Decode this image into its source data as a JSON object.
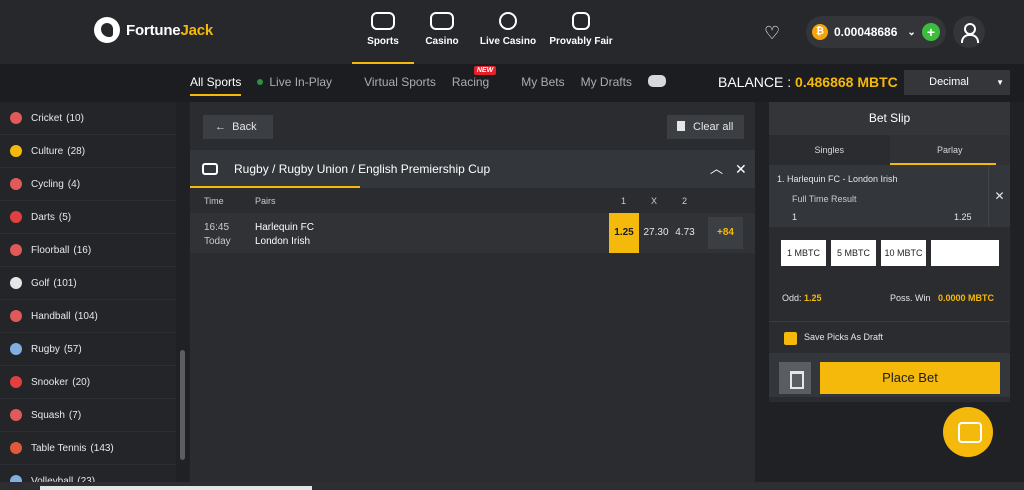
{
  "brand": {
    "name_part1": "Fortune",
    "name_part2": "Jack"
  },
  "main_nav": [
    {
      "label": "Sports"
    },
    {
      "label": "Casino"
    },
    {
      "label": "Live Casino"
    },
    {
      "label": "Provably Fair"
    }
  ],
  "wallet": {
    "amount": "0.00048686",
    "coin": "₿"
  },
  "sub_nav": {
    "tabs": [
      "All Sports",
      "Live In-Play",
      "Virtual Sports",
      "Racing",
      "My Bets",
      "My Drafts"
    ],
    "new_badge": "NEW"
  },
  "balance": {
    "label": "BALANCE : ",
    "value": "0.486868 MBTC"
  },
  "odds_format": "Decimal",
  "sidebar": {
    "items": [
      {
        "label": "Cricket",
        "count": "(10)",
        "color": "#e05a5a"
      },
      {
        "label": "Culture",
        "count": "(28)",
        "color": "#f5b90b"
      },
      {
        "label": "Cycling",
        "count": "(4)",
        "color": "#e05a5a"
      },
      {
        "label": "Darts",
        "count": "(5)",
        "color": "#e04040"
      },
      {
        "label": "Floorball",
        "count": "(16)",
        "color": "#e05a5a"
      },
      {
        "label": "Golf",
        "count": "(101)",
        "color": "#e6e6e6"
      },
      {
        "label": "Handball",
        "count": "(104)",
        "color": "#e05a5a"
      },
      {
        "label": "Rugby",
        "count": "(57)",
        "color": "#7fb0e0"
      },
      {
        "label": "Snooker",
        "count": "(20)",
        "color": "#e04040"
      },
      {
        "label": "Squash",
        "count": "(7)",
        "color": "#e05a5a"
      },
      {
        "label": "Table Tennis",
        "count": "(143)",
        "color": "#e05a3a"
      },
      {
        "label": "Volleyball",
        "count": "(23)",
        "color": "#7fb0e0"
      }
    ]
  },
  "content": {
    "back_label": "Back",
    "clear_label": "Clear all",
    "event_title": "Rugby / Rugby Union / English Premiership Cup",
    "columns": {
      "time": "Time",
      "pairs": "Pairs",
      "one": "1",
      "x": "X",
      "two": "2"
    },
    "match": {
      "time": "16:45",
      "day": "Today",
      "home": "Harlequin FC",
      "away": "London Irish",
      "odd1": "1.25",
      "oddx": "27.30",
      "odd2": "4.73",
      "more": "+84"
    }
  },
  "betslip": {
    "title": "Bet Slip",
    "tabs": [
      "Singles",
      "Parlay"
    ],
    "pick": {
      "match": "1. Harlequin FC - London Irish",
      "market": "Full Time Result",
      "selection": "1",
      "odd": "1.25"
    },
    "stakes": [
      "1 MBTC",
      "5 MBTC",
      "10 MBTC"
    ],
    "odd_label": "Odd:",
    "odd_value": "1.25",
    "win_label": "Poss. Win",
    "win_value": "0.0000 MBTC",
    "draft_label": "Save Picks As Draft",
    "place_label": "Place Bet"
  }
}
